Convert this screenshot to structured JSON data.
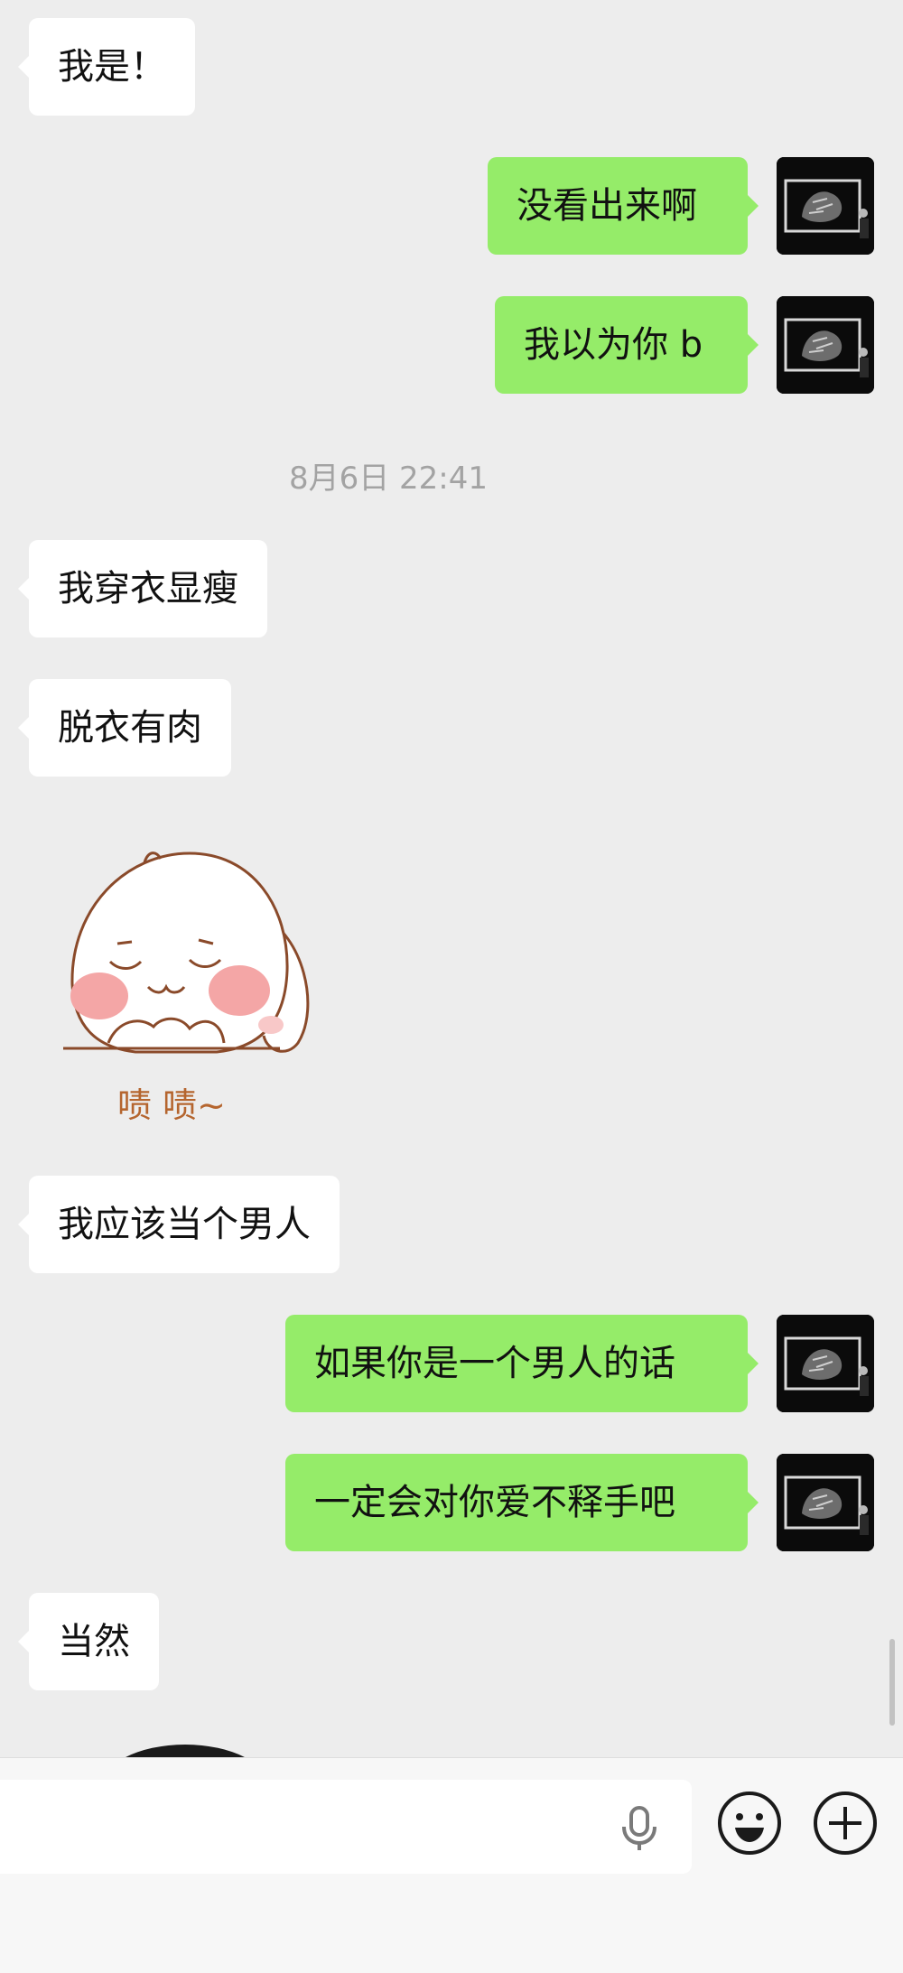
{
  "messages": [
    {
      "side": "in",
      "text": "我是！"
    },
    {
      "side": "out",
      "text": "没看出来啊"
    },
    {
      "side": "out",
      "text": "我以为你 b"
    },
    {
      "side": "in",
      "text": "我穿衣显瘦"
    },
    {
      "side": "in",
      "text": "脱衣有肉"
    },
    {
      "side": "in",
      "text": "我应该当个男人"
    },
    {
      "side": "out",
      "text": "如果你是一个男人的话"
    },
    {
      "side": "out",
      "text": "一定会对你爱不释手吧"
    },
    {
      "side": "in",
      "text": "当然"
    }
  ],
  "timestamp": "8月6日 22:41",
  "sticker": {
    "text": "啧 啧~"
  },
  "input_bar": {
    "text_value": "",
    "voice_icon": "microphone-icon",
    "emoji_icon": "smiley-icon",
    "more_icon": "plus-icon"
  },
  "colors": {
    "background": "#ededed",
    "outgoing_bubble": "#95ec69",
    "incoming_bubble": "#ffffff",
    "timestamp_text": "#a3a3a3"
  }
}
